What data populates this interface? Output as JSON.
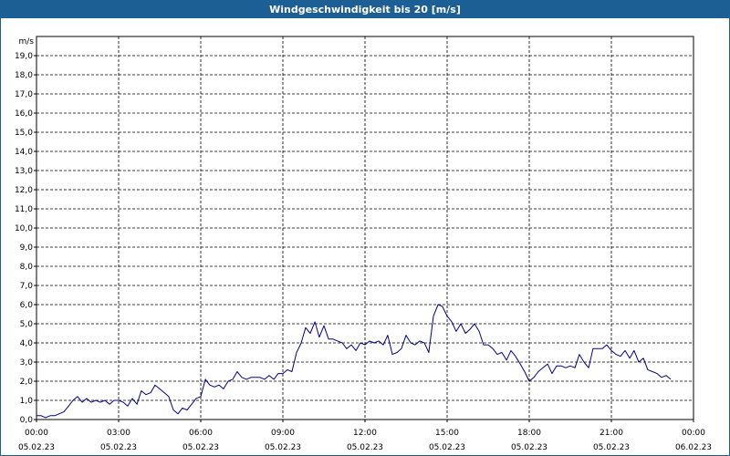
{
  "window": {
    "title": "Windgeschwindigkeit bis 20 [m/s]"
  },
  "colors": {
    "title_bar": "#1c5f95",
    "line": "#00008b",
    "grid": "#000000"
  },
  "chart_data": {
    "type": "line",
    "title": "Windgeschwindigkeit bis 20 [m/s]",
    "ylabel": "m/s",
    "ylim": [
      0,
      20
    ],
    "yticks": [
      "0,0",
      "1,0",
      "2,0",
      "3,0",
      "4,0",
      "5,0",
      "6,0",
      "7,0",
      "8,0",
      "9,0",
      "10,0",
      "11,0",
      "12,0",
      "13,0",
      "14,0",
      "15,0",
      "16,0",
      "17,0",
      "18,0",
      "19,0"
    ],
    "xlim_hours": [
      0,
      24
    ],
    "xticks": [
      {
        "time": "00:00",
        "date": "05.02.23"
      },
      {
        "time": "03:00",
        "date": "05.02.23"
      },
      {
        "time": "06:00",
        "date": "05.02.23"
      },
      {
        "time": "09:00",
        "date": "05.02.23"
      },
      {
        "time": "12:00",
        "date": "05.02.23"
      },
      {
        "time": "15:00",
        "date": "05.02.23"
      },
      {
        "time": "18:00",
        "date": "05.02.23"
      },
      {
        "time": "21:00",
        "date": "05.02.23"
      },
      {
        "time": "00:00",
        "date": "06.02.23"
      }
    ],
    "grid": true,
    "series": [
      {
        "x_hours": [
          0.0,
          0.17,
          0.33,
          0.5,
          0.67,
          0.83,
          1.0,
          1.17,
          1.33,
          1.5,
          1.67,
          1.83,
          2.0,
          2.17,
          2.33,
          2.5,
          2.67,
          2.83,
          3.0,
          3.17,
          3.33,
          3.5,
          3.67,
          3.83,
          4.0,
          4.17,
          4.33,
          4.5,
          4.67,
          4.83,
          5.0,
          5.17,
          5.33,
          5.5,
          5.67,
          5.83,
          6.0,
          6.17,
          6.33,
          6.5,
          6.67,
          6.83,
          7.0,
          7.17,
          7.33,
          7.5,
          7.67,
          7.83,
          8.0,
          8.17,
          8.33,
          8.5,
          8.67,
          8.83,
          9.0,
          9.17,
          9.33,
          9.5,
          9.67,
          9.83,
          10.0,
          10.17,
          10.33,
          10.5,
          10.67,
          10.83,
          11.0,
          11.17,
          11.33,
          11.5,
          11.67,
          11.83,
          12.0,
          12.17,
          12.33,
          12.5,
          12.67,
          12.83,
          13.0,
          13.17,
          13.33,
          13.5,
          13.67,
          13.83,
          14.0,
          14.17,
          14.33,
          14.5,
          14.67,
          14.83,
          15.0,
          15.17,
          15.33,
          15.5,
          15.67,
          15.83,
          16.0,
          16.17,
          16.33,
          16.5,
          16.67,
          16.83,
          17.0,
          17.17,
          17.33,
          17.5,
          17.67,
          17.83,
          18.0,
          18.17,
          18.33,
          18.5,
          18.67,
          18.83,
          19.0,
          19.17,
          19.33,
          19.5,
          19.67,
          19.83,
          20.0,
          20.17,
          20.33,
          20.5,
          20.67,
          20.83,
          21.0,
          21.17,
          21.33,
          21.5,
          21.67,
          21.83,
          22.0,
          22.17,
          22.33,
          22.5,
          22.67,
          22.83,
          23.0,
          23.17,
          23.33,
          23.5,
          23.67,
          23.83
        ],
        "values": [
          0.2,
          0.2,
          0.1,
          0.2,
          0.2,
          0.3,
          0.4,
          0.7,
          1.0,
          1.2,
          0.9,
          1.1,
          0.9,
          1.0,
          0.9,
          1.0,
          0.8,
          1.0,
          1.0,
          0.9,
          0.7,
          1.1,
          0.8,
          1.5,
          1.3,
          1.4,
          1.8,
          1.6,
          1.4,
          1.2,
          0.5,
          0.3,
          0.6,
          0.5,
          0.8,
          1.1,
          1.2,
          2.1,
          1.8,
          1.7,
          1.8,
          1.6,
          2.0,
          2.1,
          2.5,
          2.2,
          2.1,
          2.2,
          2.2,
          2.2,
          2.1,
          2.3,
          2.1,
          2.4,
          2.4,
          2.6,
          2.5,
          3.5,
          4.0,
          4.8,
          4.5,
          5.1,
          4.3,
          4.9,
          4.2,
          4.2,
          4.1,
          4.0,
          3.7,
          3.9,
          3.6,
          4.0,
          3.9,
          4.1,
          4.0,
          4.1,
          3.9,
          4.4,
          3.4,
          3.5,
          3.7,
          4.4,
          4.0,
          3.9,
          4.1,
          4.0,
          3.5,
          5.4,
          6.0,
          5.9,
          5.4,
          5.1,
          4.6,
          5.0,
          4.5,
          4.7,
          5.0,
          4.6,
          3.9,
          3.9,
          3.7,
          3.4,
          3.5,
          3.1,
          3.6,
          3.3,
          2.9,
          2.5,
          2.0,
          2.2,
          2.5,
          2.7,
          2.9,
          2.4,
          2.8,
          2.8,
          2.7,
          2.8,
          2.7,
          3.4,
          3.0,
          2.7,
          3.7,
          3.7,
          3.7,
          3.9,
          3.6,
          3.4,
          3.3,
          3.6,
          3.2,
          3.6,
          3.0,
          3.2,
          2.6,
          2.5,
          2.4,
          2.2,
          2.3,
          2.1
        ]
      }
    ]
  }
}
